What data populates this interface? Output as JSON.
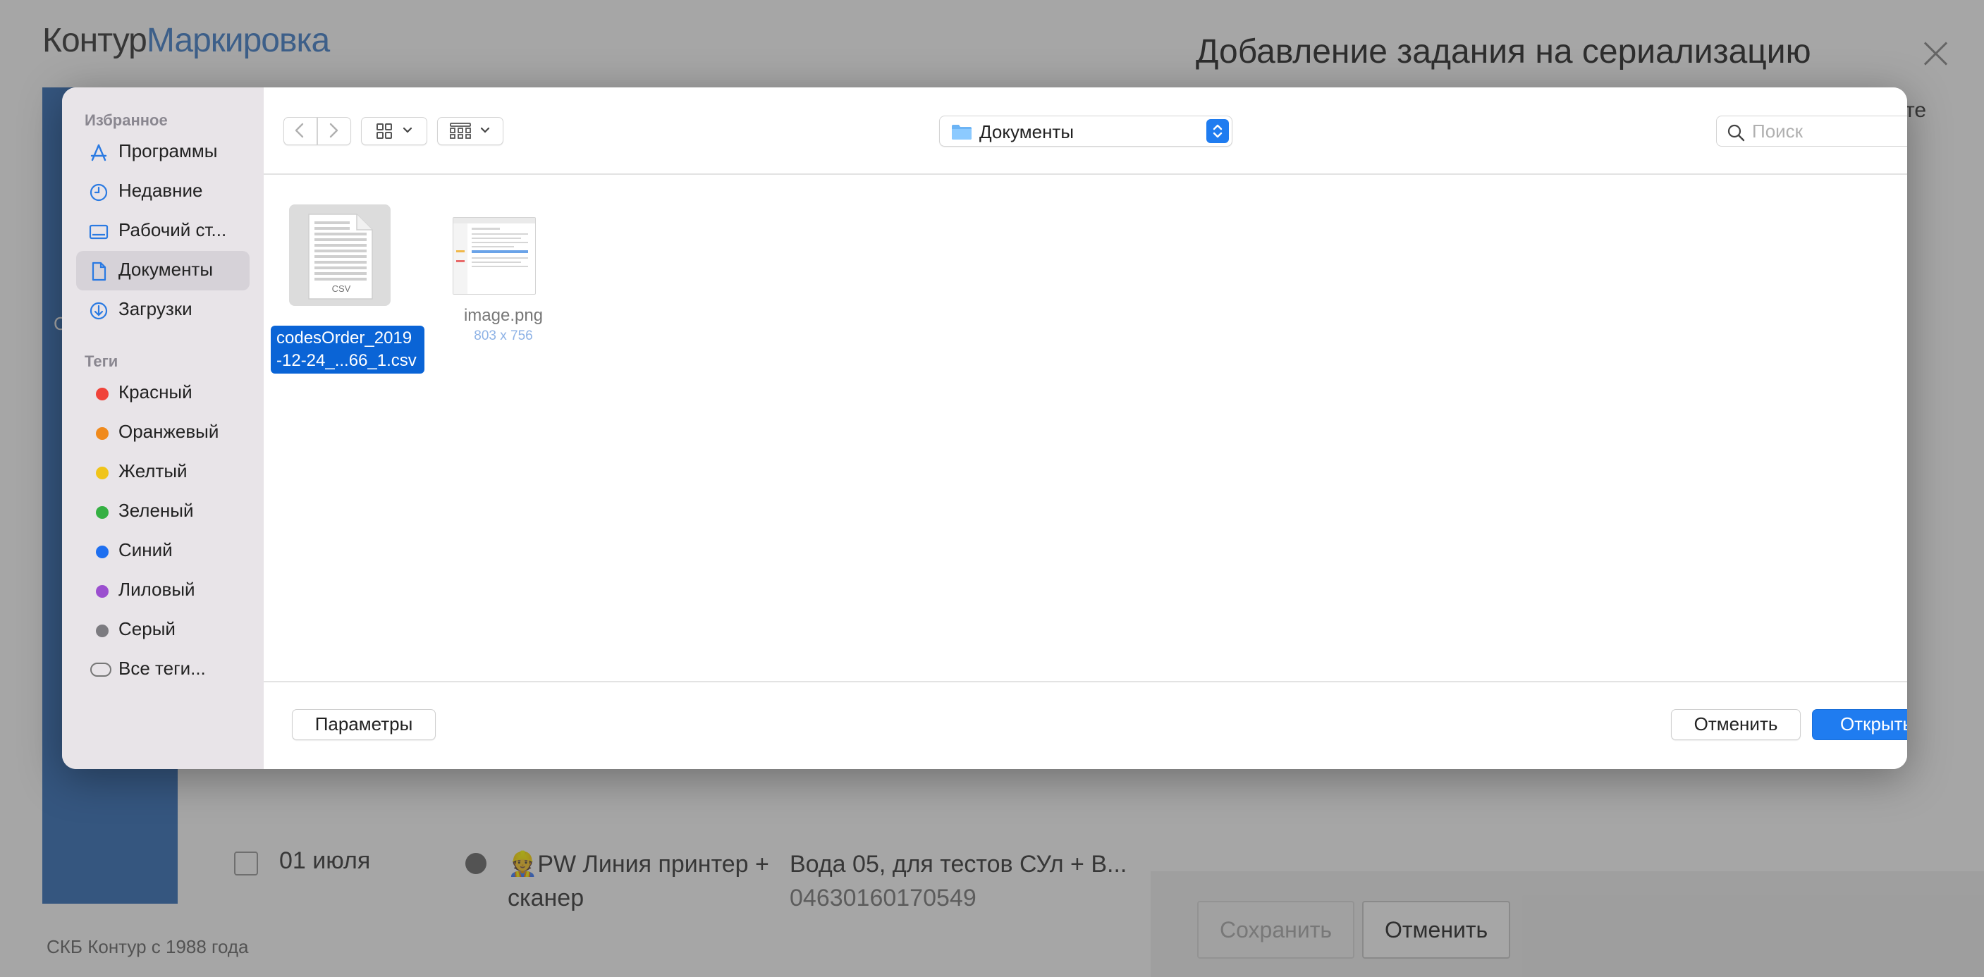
{
  "background": {
    "logo_part1": "Контур",
    "logo_part2": "Маркировка",
    "sidebar_letter": "С",
    "row": {
      "date": "01 июля",
      "line_name": "👷PW Линия принтер + сканер",
      "product_name": "Вода 05, для тестов СУл + В...",
      "gtin": "04630160170549"
    },
    "footer": "СКБ Контур с 1988 года"
  },
  "side_panel": {
    "title": "Добавление задания на сериализацию",
    "trailing_text": "те",
    "save_label": "Сохранить",
    "cancel_label": "Отменить"
  },
  "dialog": {
    "sidebar": {
      "favorites_title": "Избранное",
      "favorites": [
        {
          "label": "Программы",
          "icon": "applications-icon"
        },
        {
          "label": "Недавние",
          "icon": "recents-clock-icon"
        },
        {
          "label": "Рабочий ст...",
          "icon": "desktop-icon"
        },
        {
          "label": "Документы",
          "icon": "documents-icon",
          "selected": true
        },
        {
          "label": "Загрузки",
          "icon": "downloads-icon"
        }
      ],
      "tags_title": "Теги",
      "tags": [
        {
          "label": "Красный",
          "color": "#f0433a"
        },
        {
          "label": "Оранжевый",
          "color": "#f08a1c"
        },
        {
          "label": "Желтый",
          "color": "#f0c419"
        },
        {
          "label": "Зеленый",
          "color": "#35b043"
        },
        {
          "label": "Синий",
          "color": "#1e6ff0"
        },
        {
          "label": "Лиловый",
          "color": "#9b4fcf"
        },
        {
          "label": "Серый",
          "color": "#7c7b80"
        }
      ],
      "all_tags_label": "Все теги..."
    },
    "toolbar": {
      "location": "Документы",
      "search_placeholder": "Поиск"
    },
    "files": [
      {
        "name_line1": "codesOrder_2019",
        "name_line2": "-12-24_...66_1.csv",
        "badge": "CSV",
        "selected": true
      },
      {
        "name": "image.png",
        "meta": "803 x 756",
        "selected": false
      }
    ],
    "buttons": {
      "options": "Параметры",
      "cancel": "Отменить",
      "open": "Открыть"
    },
    "accent_color": "#1f7cf0"
  }
}
